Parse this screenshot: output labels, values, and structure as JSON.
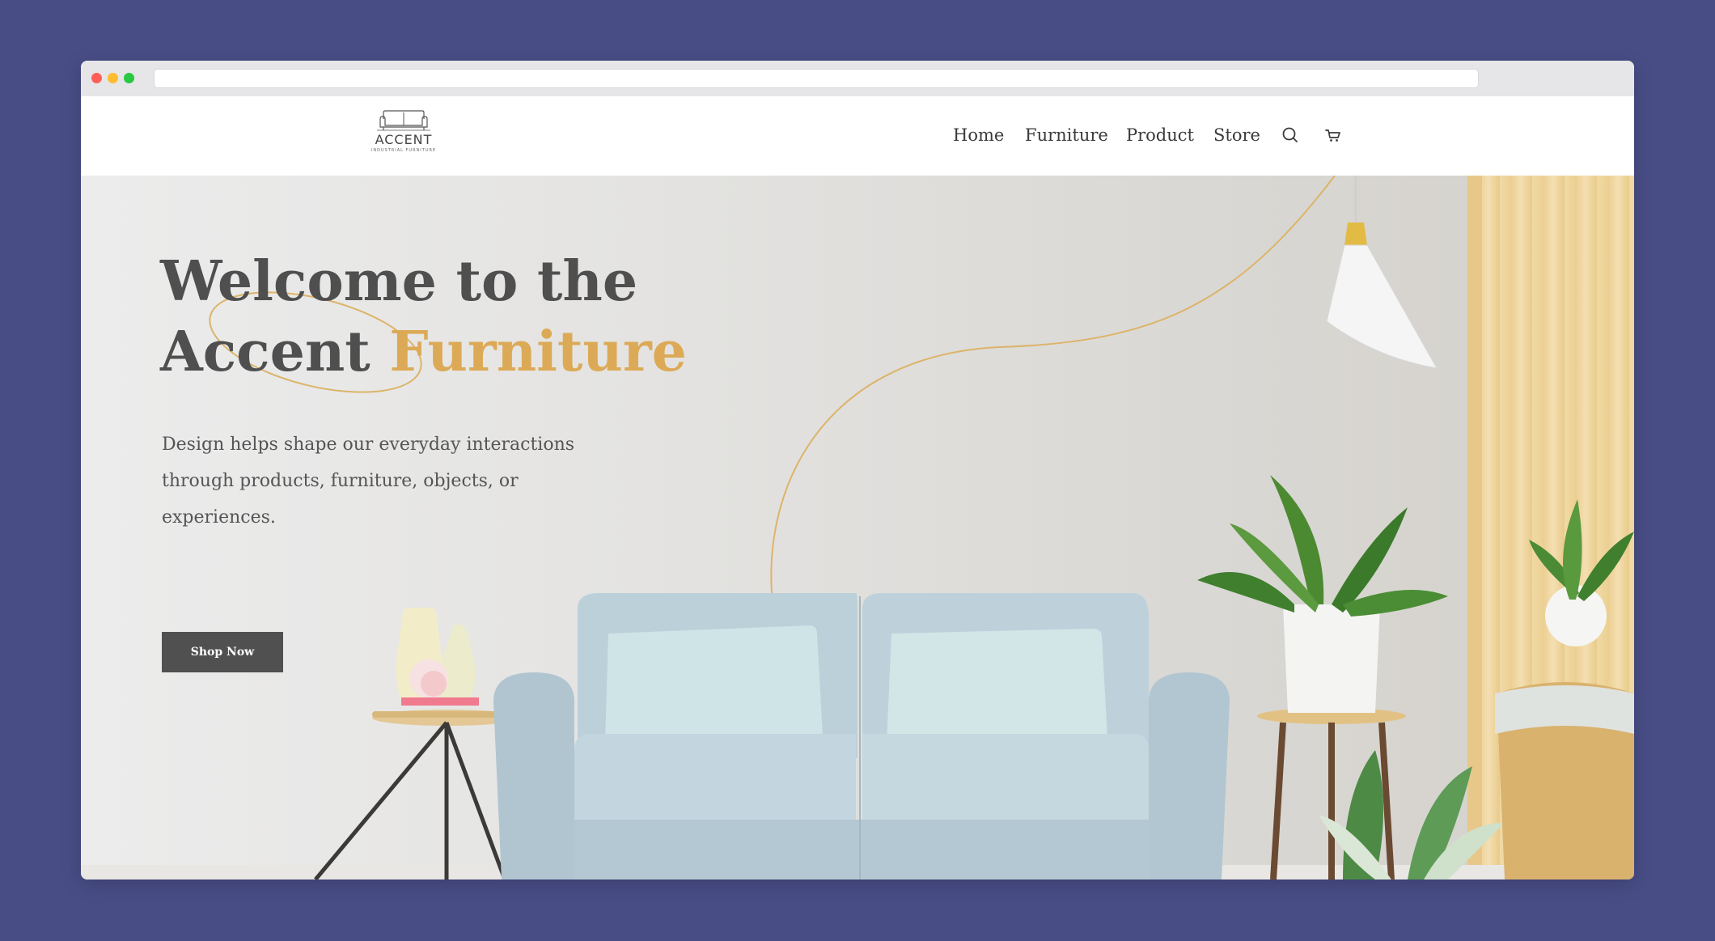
{
  "header": {
    "logo_text": "ACCENT",
    "logo_subtext": "INDUSTRIAL FURNITURE",
    "nav": {
      "home": "Home",
      "furniture": "Furniture",
      "product": "Product",
      "store": "Store"
    },
    "icons": [
      "search-icon",
      "cart-icon"
    ]
  },
  "hero": {
    "title_line1": "Welcome to the",
    "title_line2_prefix": "Accent ",
    "title_line2_accent": "Furniture",
    "description": "Design helps shape our everyday interactions through products, furniture, objects, or experiences.",
    "cta_label": "Shop Now"
  },
  "colors": {
    "page_background": "#484d86",
    "accent": "#dcaa56",
    "heading": "#4f4f4f",
    "button": "#505050"
  }
}
